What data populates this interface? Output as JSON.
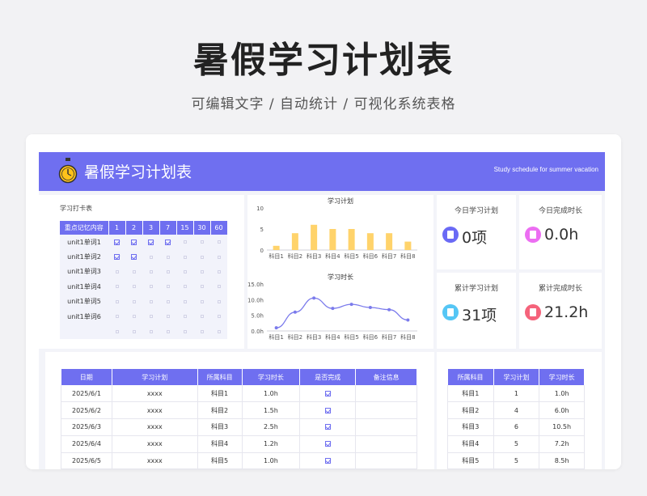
{
  "hero": {
    "title": "暑假学习计划表",
    "subtitle": "可编辑文字 / 自动统计 / 可视化系统表格"
  },
  "banner": {
    "title": "暑假学习计划表",
    "subtitle": "Study schedule for summer vacation"
  },
  "punch_card": {
    "label": "学习打卡表",
    "headers": [
      "重点记忆内容",
      "1",
      "2",
      "3",
      "7",
      "15",
      "30",
      "60"
    ],
    "rows": [
      {
        "item": "unit1单词1",
        "checks": [
          true,
          true,
          true,
          true,
          false,
          false,
          false
        ]
      },
      {
        "item": "unit1单词2",
        "checks": [
          true,
          true,
          false,
          false,
          false,
          false,
          false
        ]
      },
      {
        "item": "unit1单词3",
        "checks": [
          false,
          false,
          false,
          false,
          false,
          false,
          false
        ]
      },
      {
        "item": "unit1单词4",
        "checks": [
          false,
          false,
          false,
          false,
          false,
          false,
          false
        ]
      },
      {
        "item": "unit1单词5",
        "checks": [
          false,
          false,
          false,
          false,
          false,
          false,
          false
        ]
      },
      {
        "item": "unit1单词6",
        "checks": [
          false,
          false,
          false,
          false,
          false,
          false,
          false
        ]
      },
      {
        "item": "",
        "checks": [
          false,
          false,
          false,
          false,
          false,
          false,
          false
        ]
      }
    ]
  },
  "stats": {
    "today_plan_label": "今日学习计划",
    "today_plan_value": "0项",
    "today_done_label": "今日完成时长",
    "today_done_value": "0.0h",
    "total_plan_label": "累计学习计划",
    "total_plan_value": "31项",
    "total_done_label": "累计完成时长",
    "total_done_value": "21.2h"
  },
  "colors": {
    "accent": "#6f6ff0",
    "bar": "#ffd36b",
    "line": "#7b7bec",
    "icon_blue": "#6a6af5",
    "icon_pink": "#ec6ef2",
    "icon_cyan": "#55c6f5",
    "icon_red": "#f5637b"
  },
  "chart_data": [
    {
      "type": "bar",
      "title": "学习计划",
      "categories": [
        "科目1",
        "科目2",
        "科目3",
        "科目4",
        "科目5",
        "科目6",
        "科目7",
        "科目8"
      ],
      "values": [
        1,
        4,
        6,
        5,
        5,
        4,
        4,
        2
      ],
      "yticks": [
        "0",
        "5",
        "10"
      ],
      "ylim": [
        0,
        10
      ],
      "grid": false
    },
    {
      "type": "line",
      "title": "学习时长",
      "categories": [
        "科目1",
        "科目2",
        "科目3",
        "科目4",
        "科目5",
        "科目6",
        "科目7",
        "科目8"
      ],
      "values": [
        1.0,
        6.0,
        10.5,
        7.2,
        8.5,
        7.5,
        6.8,
        3.5
      ],
      "yticks": [
        "0.0h",
        "5.0h",
        "10.0h",
        "15.0h"
      ],
      "ylim": [
        0,
        15
      ],
      "grid": false
    }
  ],
  "daily_table": {
    "headers": [
      "日期",
      "学习计划",
      "所属科目",
      "学习时长",
      "是否完成",
      "备注信息"
    ],
    "rows": [
      {
        "date": "2025/6/1",
        "plan": "xxxx",
        "subject": "科目1",
        "hours": "1.0h",
        "done": true,
        "note": ""
      },
      {
        "date": "2025/6/2",
        "plan": "xxxx",
        "subject": "科目2",
        "hours": "1.5h",
        "done": true,
        "note": ""
      },
      {
        "date": "2025/6/3",
        "plan": "xxxx",
        "subject": "科目3",
        "hours": "2.5h",
        "done": true,
        "note": ""
      },
      {
        "date": "2025/6/4",
        "plan": "xxxx",
        "subject": "科目4",
        "hours": "1.2h",
        "done": true,
        "note": ""
      },
      {
        "date": "2025/6/5",
        "plan": "xxxx",
        "subject": "科目5",
        "hours": "1.0h",
        "done": true,
        "note": ""
      }
    ]
  },
  "summary_table": {
    "headers": [
      "所属科目",
      "学习计划",
      "学习时长"
    ],
    "rows": [
      {
        "subject": "科目1",
        "count": "1",
        "hours": "1.0h"
      },
      {
        "subject": "科目2",
        "count": "4",
        "hours": "6.0h"
      },
      {
        "subject": "科目3",
        "count": "6",
        "hours": "10.5h"
      },
      {
        "subject": "科目4",
        "count": "5",
        "hours": "7.2h"
      },
      {
        "subject": "科目5",
        "count": "5",
        "hours": "8.5h"
      }
    ]
  }
}
